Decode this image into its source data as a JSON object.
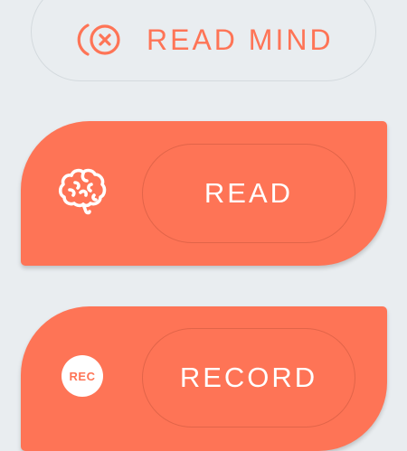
{
  "buttons": {
    "read_mind": {
      "label": "READ MIND",
      "icon": "mind-read-icon"
    },
    "read": {
      "label": "READ",
      "icon": "brain-icon"
    },
    "record": {
      "label": "RECORD",
      "icon": "rec-icon",
      "badge_text": "REC"
    }
  },
  "colors": {
    "accent": "#fe7456",
    "background": "#e9edf0",
    "text_on_accent": "#ffffff"
  }
}
